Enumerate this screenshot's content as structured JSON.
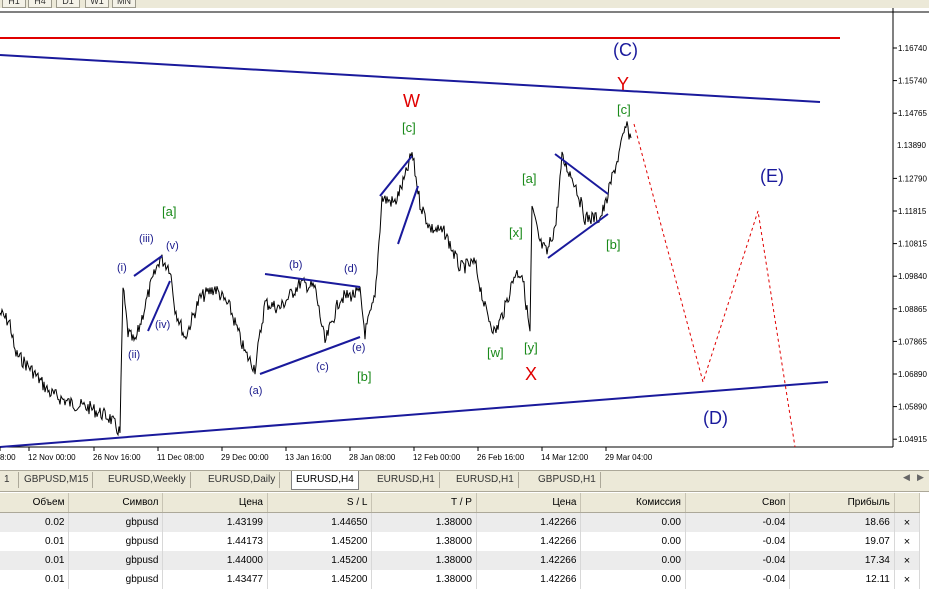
{
  "period_buttons": [
    "H1",
    "H4",
    "D1",
    "W1",
    "MN"
  ],
  "chart": {
    "price_axis": [
      "1.16740",
      "1.15740",
      "1.14765",
      "1.13890",
      "1.12790",
      "1.11815",
      "1.10815",
      "1.09840",
      "1.08865",
      "1.07865",
      "1.06890",
      "1.05890",
      "1.04915"
    ],
    "current_price": "1.13890",
    "time_axis": [
      "8:00",
      "12 Nov 00:00",
      "26 Nov 16:00",
      "11 Dec 08:00",
      "29 Dec 00:00",
      "13 Jan 16:00",
      "28 Jan 08:00",
      "12 Feb 00:00",
      "26 Feb 16:00",
      "14 Mar 12:00",
      "29 Mar 04:00"
    ],
    "labels": {
      "C_big": "(C)",
      "Y": "Y",
      "W": "W",
      "X": "X",
      "E_big": "(E)",
      "D_big": "(D)",
      "c_W": "[c]",
      "c_Y": "[c]",
      "a_1": "[a]",
      "a_2": "[a]",
      "x_g": "[x]",
      "w_g": "[w]",
      "y_g": "[y]",
      "b_1": "[b]",
      "b_2": "[b]",
      "i": "(i)",
      "ii": "(ii)",
      "iii": "(iii)",
      "iv": "(iv)",
      "v": "(v)",
      "a_s": "(a)",
      "b_s": "(b)",
      "c_s": "(c)",
      "d_s": "(d)",
      "e_s": "(e)"
    },
    "colors": {
      "red_line": "#e00000",
      "channel": "#1a1a9c",
      "price": "#000000",
      "forecast": "#e00000"
    }
  },
  "tabs": [
    "1",
    "GBPUSD,M15",
    "EURUSD,Weekly",
    "EURUSD,Daily",
    "EURUSD,H4",
    "EURUSD,H1",
    "EURUSD,H1",
    "GBPUSD,H1"
  ],
  "active_tab": "EURUSD,H4",
  "orders": {
    "columns": [
      "Объем",
      "Символ",
      "Цена",
      "S / L",
      "T / P",
      "Цена",
      "Комиссия",
      "Своп",
      "Прибыль"
    ],
    "rows": [
      [
        "0.02",
        "gbpusd",
        "1.43199",
        "1.44650",
        "1.38000",
        "1.42266",
        "0.00",
        "-0.04",
        "18.66"
      ],
      [
        "0.01",
        "gbpusd",
        "1.44173",
        "1.45200",
        "1.38000",
        "1.42266",
        "0.00",
        "-0.04",
        "19.07"
      ],
      [
        "0.01",
        "gbpusd",
        "1.44000",
        "1.45200",
        "1.38000",
        "1.42266",
        "0.00",
        "-0.04",
        "17.34"
      ],
      [
        "0.01",
        "gbpusd",
        "1.43477",
        "1.45200",
        "1.38000",
        "1.42266",
        "0.00",
        "-0.04",
        "12.11"
      ]
    ],
    "close_icon": "×"
  }
}
